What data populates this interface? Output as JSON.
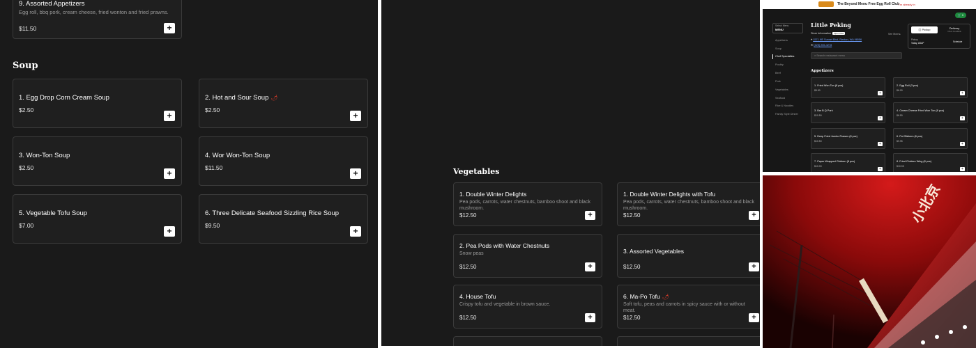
{
  "pane_left": {
    "top_card": {
      "name": "9. Assorted Appetizers",
      "desc": "Egg roll, bbq pork, cream cheese, fried wonton and fried prawns.",
      "price": "$11.50"
    },
    "section_title": "Soup",
    "items": [
      {
        "name": "1. Egg Drop Corn Cream Soup",
        "price": "$2.50",
        "spicy": false
      },
      {
        "name": "2. Hot and Sour Soup",
        "price": "$2.50",
        "spicy": true
      },
      {
        "name": "3. Won-Ton Soup",
        "price": "$2.50",
        "spicy": false
      },
      {
        "name": "4. Wor Won-Ton Soup",
        "price": "$11.50",
        "spicy": false
      },
      {
        "name": "5. Vegetable Tofu Soup",
        "price": "$7.00",
        "spicy": false
      },
      {
        "name": "6. Three Delicate Seafood Sizzling Rice Soup",
        "price": "$9.50",
        "spicy": false
      }
    ],
    "add_label": "+"
  },
  "pane_middle": {
    "section_title": "Vegetables",
    "items": [
      {
        "name": "1. Double Winter Delights",
        "desc": "Pea pods, carrots, water chestnuts, bamboo shoot and black mushroom.",
        "price": "$12.50",
        "spicy": false
      },
      {
        "name": "1. Double Winter Delights with Tofu",
        "desc": "Pea pods, carrots, water chestnuts, bamboo shoot and black mushroom.",
        "price": "$12.50",
        "spicy": false
      },
      {
        "name": "2. Pea Pods with Water Chestnuts",
        "desc": "Snow peas",
        "price": "$12.50",
        "spicy": false
      },
      {
        "name": "3. Assorted Vegetables",
        "desc": "",
        "price": "$12.50",
        "spicy": false
      },
      {
        "name": "4. House Tofu",
        "desc": "Crispy tofu and vegetable in brown sauce.",
        "price": "$12.50",
        "spicy": false
      },
      {
        "name": "6. Ma-Po Tofu",
        "desc": "Soft tofu, peas and carrots in spicy sauce with or without meat.",
        "price": "$12.50",
        "spicy": true
      }
    ],
    "add_label": "+"
  },
  "pane_right_top": {
    "ad": {
      "text": "The Beyond Menu Free Egg Roll Club",
      "cta": "I'm already in"
    },
    "cart": "0",
    "select_menu": {
      "label": "Select Menu",
      "value": "MENU"
    },
    "nav": [
      "Appetizers",
      "Soup",
      "Chef Specialties",
      "Poultry",
      "Beef",
      "Pork",
      "Vegetables",
      "Seafood",
      "Rice & Noodles",
      "Family Style Dinner"
    ],
    "active_nav": "Chef Specialties",
    "restaurant": "Little Peking",
    "store_info": "Store Information",
    "open_badge": "Open Now",
    "address": "1571 NE Sunset Blvd, Renton, WA 98056",
    "phone": "(425) 255-4278",
    "see_more": "See More",
    "pickup": "Pickup",
    "delivery": "Delivery",
    "delivery_note": "Check if available",
    "pickup_label": "Pickup",
    "pickup_time": "Today, ASAP",
    "schedule": "Schedule",
    "search_placeholder": "Search restaurant menu",
    "section_title": "Appetizers",
    "items": [
      {
        "name": "1. Fried Won Ton (8 pcs)",
        "price": "$5.50"
      },
      {
        "name": "2. Egg Roll (3 pcs)",
        "price": "$6.00"
      },
      {
        "name": "3. Bar B.Q Pork",
        "price": "$10.50"
      },
      {
        "name": "4. Cream Cheese Fried Won Ton (8 pcs)",
        "price": "$6.50"
      },
      {
        "name": "5. Deep Fried Jumbo Prawns (8 pcs)",
        "price": "$10.50"
      },
      {
        "name": "6. Pot Stickers (6 pcs)",
        "price": "$9.95"
      },
      {
        "name": "7. Paper Wrapped Chicken (8 pcs)",
        "price": "$10.00"
      },
      {
        "name": "8. Fried Chicken Wing (8 pcs)",
        "price": "$10.95"
      }
    ]
  },
  "pane_right_bottom": {
    "photo_colors": {
      "sky": "#b01515",
      "sign": "#e8d9c0"
    }
  }
}
